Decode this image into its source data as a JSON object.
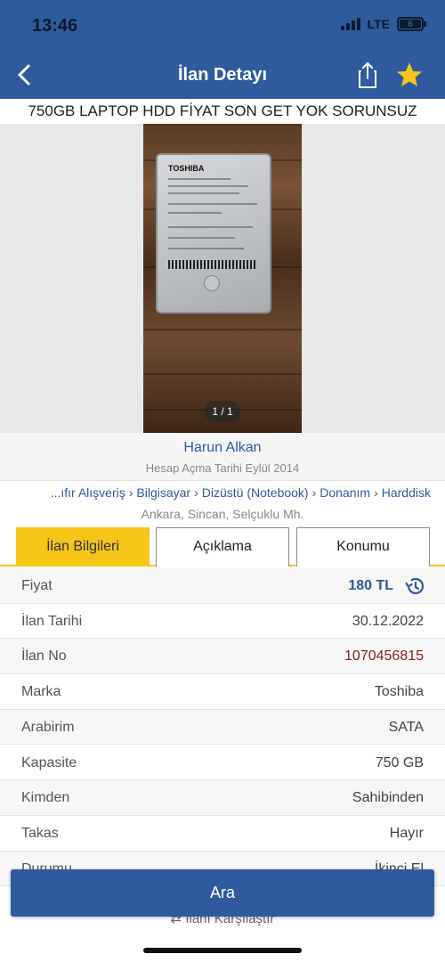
{
  "status_bar": {
    "time": "13:46",
    "network": "LTE",
    "battery": "6"
  },
  "header": {
    "title": "İlan Detayı"
  },
  "listing": {
    "title": "750GB LAPTOP HDD FİYAT SON GET YOK SORUNSUZ"
  },
  "gallery": {
    "counter": "1 / 1",
    "image_brand": "TOSHIBA"
  },
  "seller": {
    "name": "Harun Alkan",
    "since": "Hesap Açma Tarihi  Eylül 2014"
  },
  "breadcrumb": [
    "...ıfır Alışveriş",
    "Bilgisayar",
    "Dizüstü (Notebook)",
    "Donanım",
    "Harddisk"
  ],
  "location": "Ankara, Sincan, Selçuklu Mh.",
  "tabs": [
    {
      "label": "İlan Bilgileri",
      "active": true
    },
    {
      "label": "Açıklama",
      "active": false
    },
    {
      "label": "Konumu",
      "active": false
    }
  ],
  "details": {
    "price": {
      "label": "Fiyat",
      "value": "180 TL"
    },
    "date": {
      "label": "İlan Tarihi",
      "value": "30.12.2022"
    },
    "id": {
      "label": "İlan No",
      "value": "1070456815"
    },
    "brand": {
      "label": "Marka",
      "value": "Toshiba"
    },
    "interface": {
      "label": "Arabirim",
      "value": "SATA"
    },
    "capacity": {
      "label": "Kapasite",
      "value": "750 GB"
    },
    "from": {
      "label": "Kimden",
      "value": "Sahibinden"
    },
    "exchange": {
      "label": "Takas",
      "value": "Hayır"
    },
    "condition": {
      "label": "Durumu",
      "value": "İkinci El"
    }
  },
  "actions": {
    "call": "Ara",
    "compare": "İlanı Karşılaştır"
  },
  "colors": {
    "primary": "#2f5a9e",
    "accent": "#f5c518",
    "id_text": "#8b1c1c"
  }
}
